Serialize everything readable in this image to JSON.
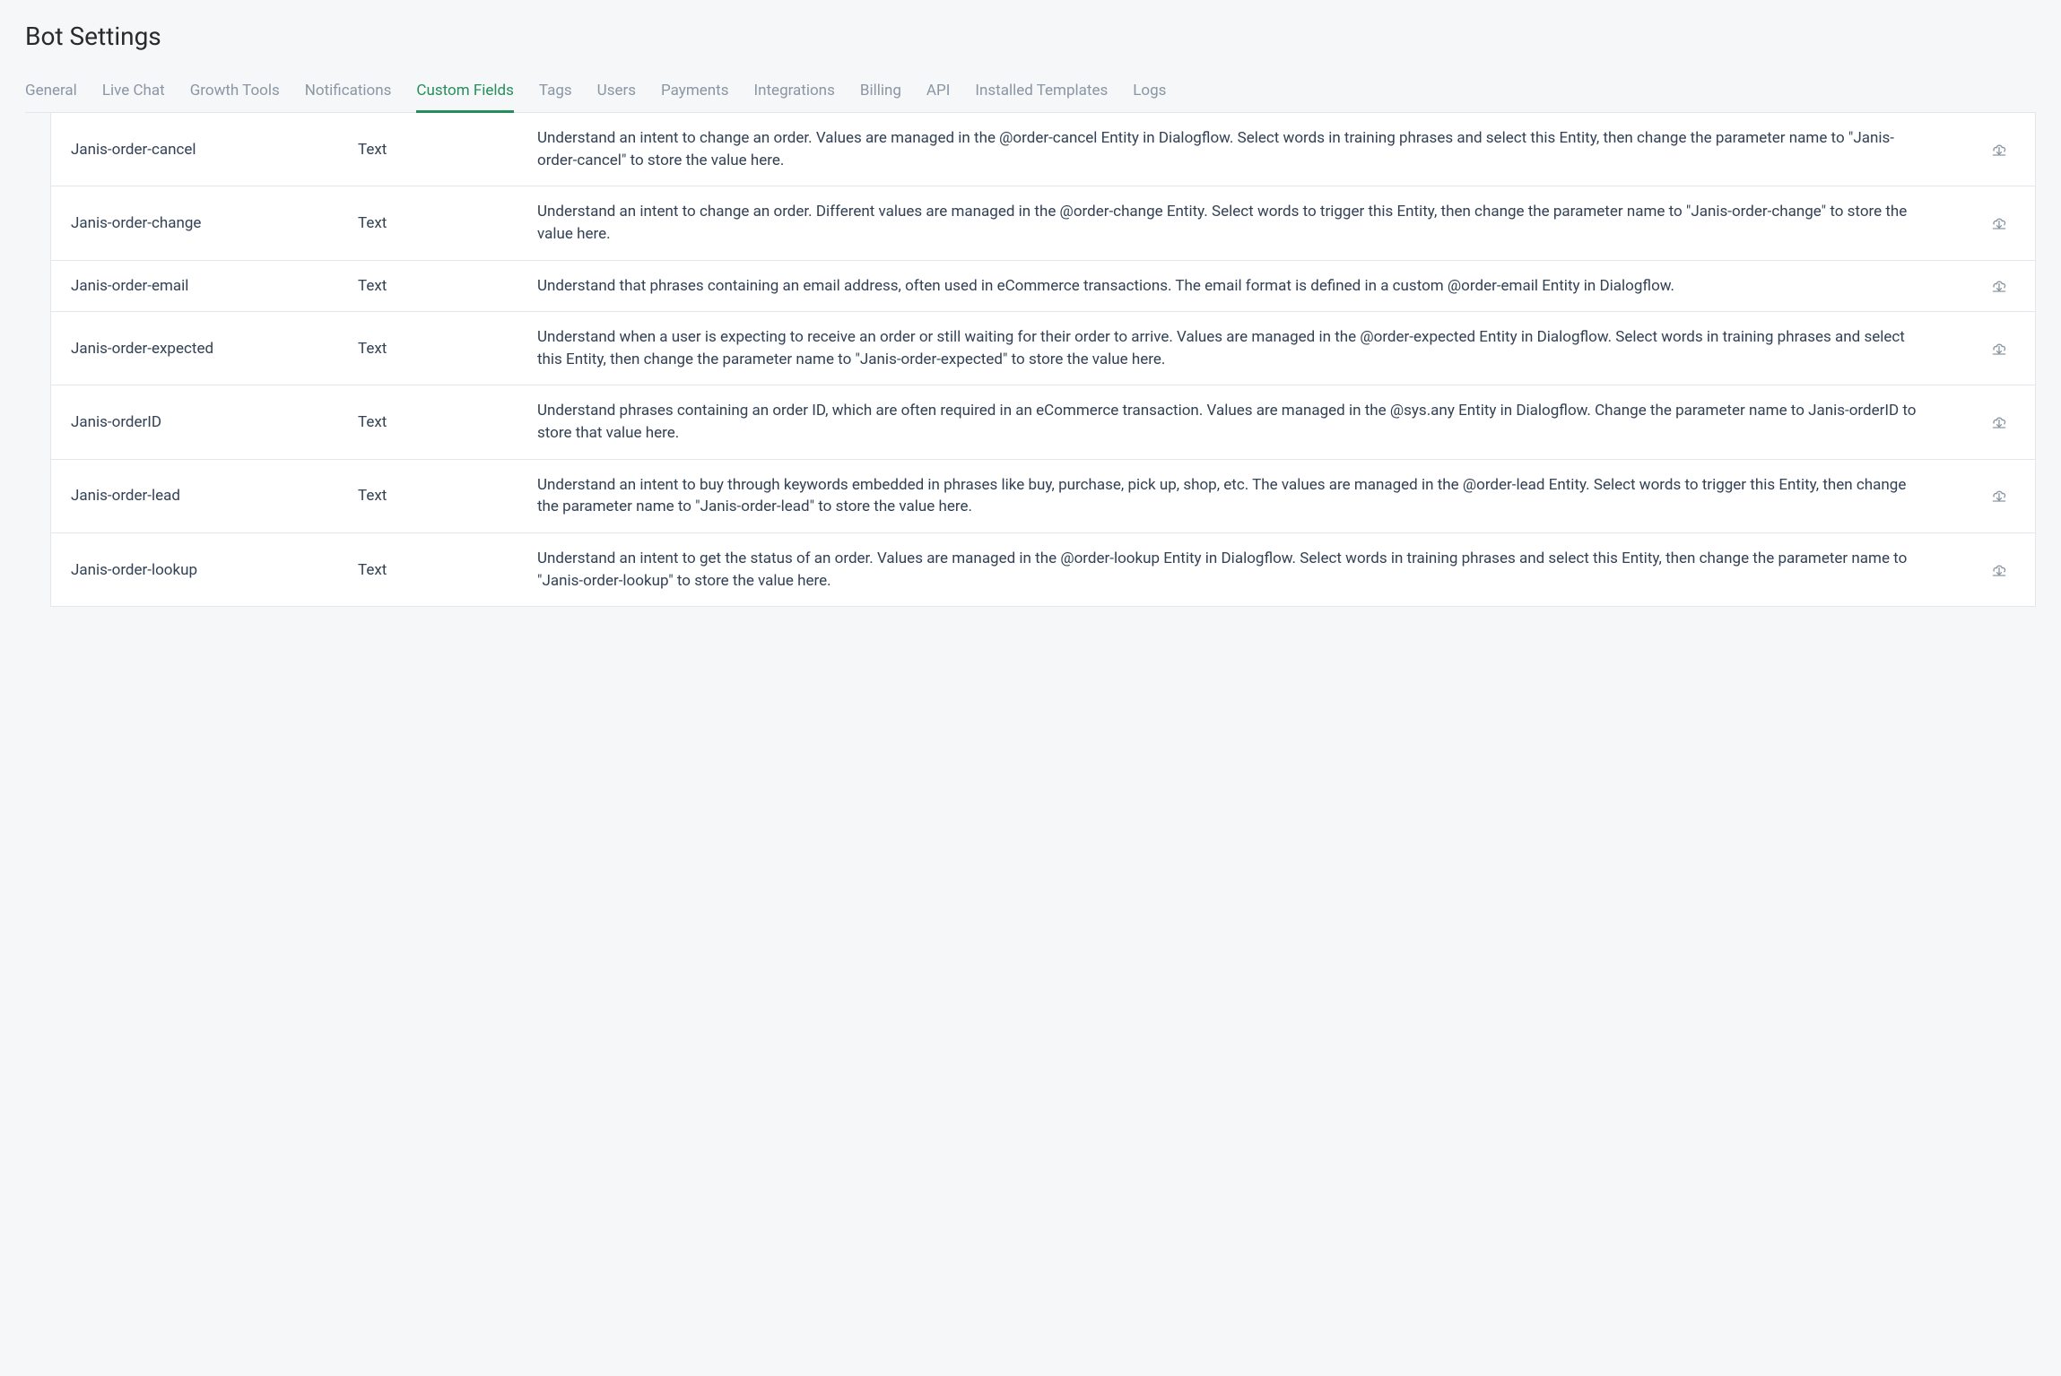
{
  "pageTitle": "Bot Settings",
  "tabs": [
    {
      "label": "General",
      "active": false,
      "name": "tab-general"
    },
    {
      "label": "Live Chat",
      "active": false,
      "name": "tab-live-chat"
    },
    {
      "label": "Growth Tools",
      "active": false,
      "name": "tab-growth-tools"
    },
    {
      "label": "Notifications",
      "active": false,
      "name": "tab-notifications"
    },
    {
      "label": "Custom Fields",
      "active": true,
      "name": "tab-custom-fields"
    },
    {
      "label": "Tags",
      "active": false,
      "name": "tab-tags"
    },
    {
      "label": "Users",
      "active": false,
      "name": "tab-users"
    },
    {
      "label": "Payments",
      "active": false,
      "name": "tab-payments"
    },
    {
      "label": "Integrations",
      "active": false,
      "name": "tab-integrations"
    },
    {
      "label": "Billing",
      "active": false,
      "name": "tab-billing"
    },
    {
      "label": "API",
      "active": false,
      "name": "tab-api"
    },
    {
      "label": "Installed Templates",
      "active": false,
      "name": "tab-installed-templates"
    },
    {
      "label": "Logs",
      "active": false,
      "name": "tab-logs"
    }
  ],
  "fields": [
    {
      "name": "Janis-order-cancel",
      "type": "Text",
      "description": "Understand an intent to change an order. Values are managed in the @order-cancel Entity in Dialogflow. Select words in training phrases and select this Entity, then change the parameter name to \"Janis-order-cancel\" to store the value here."
    },
    {
      "name": "Janis-order-change",
      "type": "Text",
      "description": "Understand an intent to change an order. Different values are managed in the @order-change Entity. Select words to trigger this Entity, then change the parameter name to \"Janis-order-change\" to store the value here."
    },
    {
      "name": "Janis-order-email",
      "type": "Text",
      "description": "Understand that phrases containing an email address, often used in eCommerce transactions. The email format is defined in a custom @order-email Entity in Dialogflow."
    },
    {
      "name": "Janis-order-expected",
      "type": "Text",
      "description": "Understand when a user is expecting to receive an order or still waiting for their order to arrive. Values are managed in the @order-expected Entity in Dialogflow. Select words in training phrases and select this Entity, then change the parameter name to \"Janis-order-expected\" to store the value here."
    },
    {
      "name": "Janis-orderID",
      "type": "Text",
      "description": "Understand phrases containing an order ID, which are often required in an eCommerce transaction. Values are managed in the @sys.any Entity in Dialogflow. Change the parameter name to Janis-orderID to store that value here."
    },
    {
      "name": "Janis-order-lead",
      "type": "Text",
      "description": "Understand an intent to buy through keywords embedded in phrases like buy, purchase, pick up, shop, etc. The values are managed in the @order-lead Entity. Select words to trigger this Entity, then change the parameter name to \"Janis-order-lead\" to store the value here."
    },
    {
      "name": "Janis-order-lookup",
      "type": "Text",
      "description": "Understand an intent to get the status of an order. Values are managed in the @order-lookup Entity in Dialogflow. Select words in training phrases and select this Entity, then change the parameter name to \"Janis-order-lookup\" to store the value here."
    }
  ]
}
